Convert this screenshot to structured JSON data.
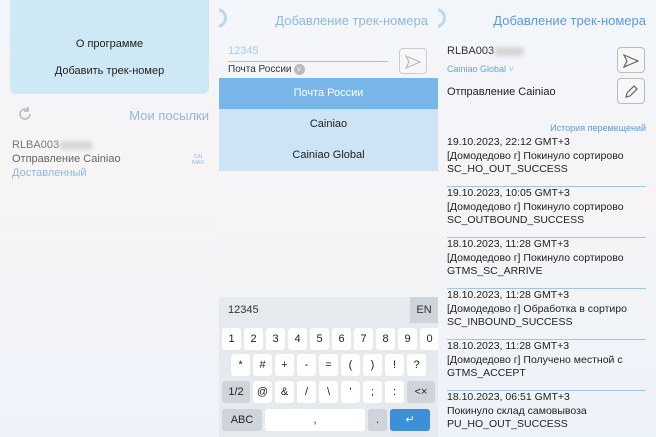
{
  "panel1": {
    "menu": {
      "about": "О программе",
      "add_track": "Добавить трек-номер"
    },
    "title": "Мои посылки",
    "parcel": {
      "track": "RLBA003",
      "carrier": "Отправление Cainiao",
      "status": "Доставленный",
      "logo": "CAI NIAO"
    }
  },
  "panel2": {
    "title": "Добавление трек-номера",
    "track_input": "12345",
    "carrier_selected": "Почта России",
    "options": [
      "Почта России",
      "Cainiao",
      "Cainiao Global"
    ],
    "keyboard": {
      "suggestion": "12345",
      "lang": "EN",
      "row1": [
        "1",
        "2",
        "3",
        "4",
        "5",
        "6",
        "7",
        "8",
        "9",
        "0"
      ],
      "row2": [
        "*",
        "#",
        "+",
        "-",
        "=",
        "(",
        ")",
        "!",
        "?"
      ],
      "row3": [
        "1/2",
        "@",
        "&",
        "/",
        "\\",
        "'",
        ";",
        ":",
        "<×"
      ],
      "row4": [
        "ABC",
        ",",
        ".",
        "↵"
      ]
    }
  },
  "panel3": {
    "title": "Добавление трек-номера",
    "track": "RLBA003",
    "carrier": "Cainiao Global",
    "shipment": "Отправление Cainiao",
    "history_link": "История перемещений",
    "events": [
      {
        "date": "19.10.2023, 22:12 GMT+3",
        "desc": "[Домодедово г] Покинуло сортирово",
        "code": "SC_HO_OUT_SUCCESS"
      },
      {
        "date": "19.10.2023, 10:05 GMT+3",
        "desc": "[Домодедово г] Покинуло сортирово",
        "code": "SC_OUTBOUND_SUCCESS"
      },
      {
        "date": "18.10.2023, 11:28 GMT+3",
        "desc": "[Домодедово г] Покинуло сортирово",
        "code": "GTMS_SC_ARRIVE"
      },
      {
        "date": "18.10.2023, 11:28 GMT+3",
        "desc": "[Домодедово г] Обработка в сортиро",
        "code": "SC_INBOUND_SUCCESS"
      },
      {
        "date": "18.10.2023, 11:28 GMT+3",
        "desc": "[Домодедово г] Получено местной с",
        "code": "GTMS_ACCEPT"
      },
      {
        "date": "18.10.2023, 06:51 GMT+3",
        "desc": "Покинуло склад самовывоза",
        "code": "PU_HO_OUT_SUCCESS"
      }
    ]
  }
}
